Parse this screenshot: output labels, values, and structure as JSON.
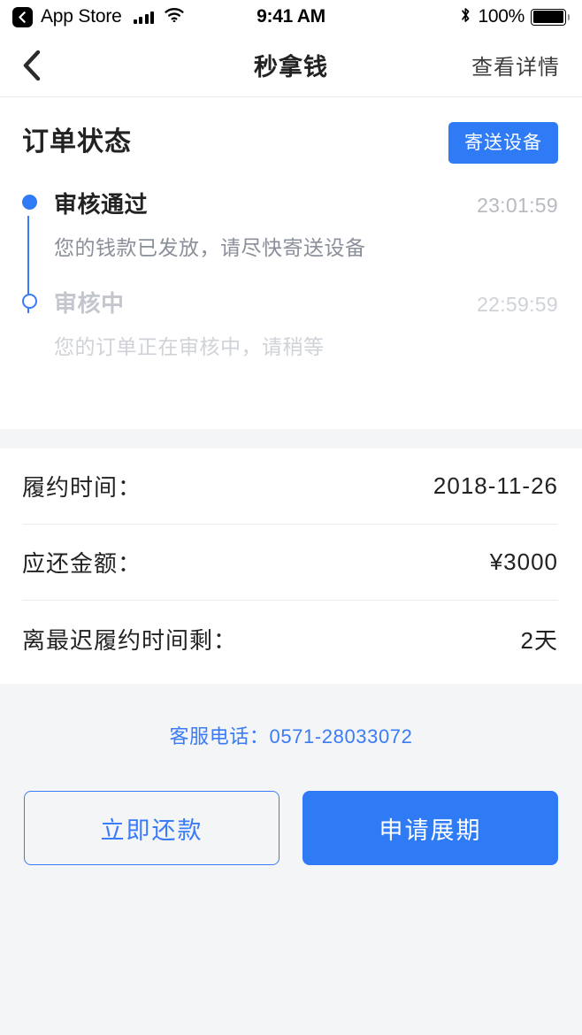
{
  "status_bar": {
    "back_app": "App Store",
    "time": "9:41 AM",
    "battery_percent": "100%",
    "icons": [
      "back-chevron-badge-icon",
      "cellular-signal-icon",
      "wifi-icon",
      "bluetooth-icon",
      "battery-icon"
    ]
  },
  "nav": {
    "back_icon": "chevron-left-icon",
    "title": "秒拿钱",
    "right_action": "查看详情"
  },
  "order_status": {
    "heading": "订单状态",
    "action_button": "寄送设备",
    "timeline": [
      {
        "label": "审核通过",
        "time": "23:01:59",
        "desc": "您的钱款已发放，请尽快寄送设备",
        "state": "done",
        "marker": "filled-dot-icon"
      },
      {
        "label": "审核中",
        "time": "22:59:59",
        "desc": "您的订单正在审核中，请稍等",
        "state": "pending",
        "marker": "hollow-dot-icon"
      }
    ]
  },
  "details": [
    {
      "label": "履约时间：",
      "value": "2018-11-26"
    },
    {
      "label": "应还金额：",
      "value": "¥3000"
    },
    {
      "label": "离最迟履约时间剩：",
      "value": "2天"
    }
  ],
  "footer": {
    "hotline": "客服电话：0571-28033072",
    "secondary_button": "立即还款",
    "primary_button": "申请展期"
  },
  "colors": {
    "accent": "#2f7bf6",
    "link": "#3a7bf7",
    "muted_text": "#c3c6cc",
    "band": "#f4f5f7",
    "divider": "#ececec"
  }
}
